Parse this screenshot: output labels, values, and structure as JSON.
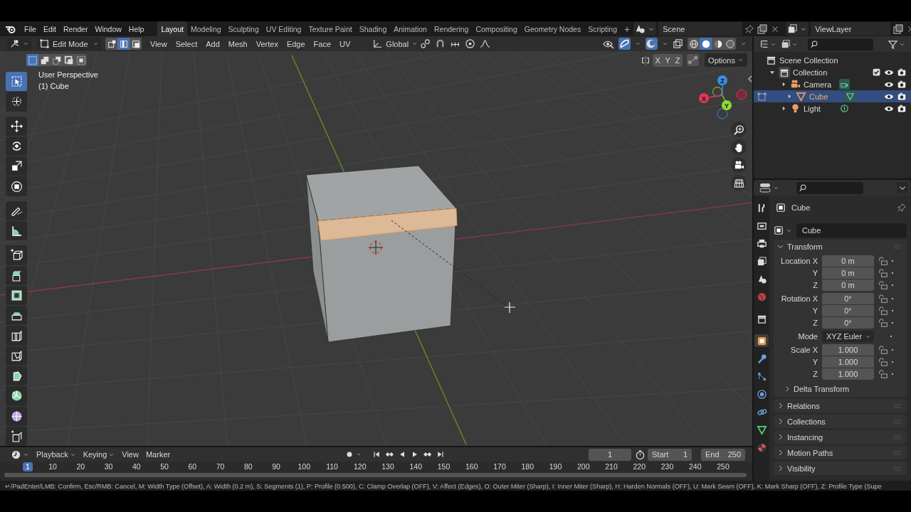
{
  "top_bar": {
    "menus": [
      "File",
      "Edit",
      "Render",
      "Window",
      "Help"
    ],
    "workspaces": [
      {
        "label": "Layout",
        "selected": true
      },
      {
        "label": "Modeling",
        "selected": false
      },
      {
        "label": "Sculpting",
        "selected": false
      },
      {
        "label": "UV Editing",
        "selected": false
      },
      {
        "label": "Texture Paint",
        "selected": false
      },
      {
        "label": "Shading",
        "selected": false
      },
      {
        "label": "Animation",
        "selected": false
      },
      {
        "label": "Rendering",
        "selected": false
      },
      {
        "label": "Compositing",
        "selected": false
      },
      {
        "label": "Geometry Nodes",
        "selected": false
      },
      {
        "label": "Scripting",
        "selected": false
      }
    ],
    "add_workspace": "+",
    "scene": "Scene",
    "view_layer": "ViewLayer"
  },
  "viewport": {
    "mode": "Edit Mode",
    "select_modes": [
      {
        "kind": "vertex",
        "selected": false
      },
      {
        "kind": "edge",
        "selected": true
      },
      {
        "kind": "face",
        "selected": false
      }
    ],
    "menus": [
      "View",
      "Select",
      "Add",
      "Mesh",
      "Vertex",
      "Edge",
      "Face",
      "UV"
    ],
    "orientation": "Global",
    "shading_modes": [
      {
        "kind": "wireframe",
        "selected": false
      },
      {
        "kind": "solid",
        "selected": true
      },
      {
        "kind": "material",
        "selected": false
      },
      {
        "kind": "rendered",
        "selected": false
      }
    ],
    "box_modes": [
      {
        "kind": "set",
        "selected": true
      },
      {
        "kind": "extend",
        "selected": false
      },
      {
        "kind": "subtract",
        "selected": false
      },
      {
        "kind": "invert",
        "selected": false
      },
      {
        "kind": "intersect",
        "selected": false
      }
    ],
    "mirror_axes": [
      "X",
      "Y",
      "Z"
    ],
    "options": "Options",
    "view_name": "User Perspective",
    "object_label": "(1) Cube",
    "gizmo_axes": [
      "X",
      "Y",
      "Z"
    ],
    "tools": [
      {
        "kind": "select_box",
        "selected": true
      },
      {
        "kind": "cursor",
        "selected": false
      },
      {
        "kind": "move",
        "selected": false
      },
      {
        "kind": "rotate",
        "selected": false
      },
      {
        "kind": "scale",
        "selected": false
      },
      {
        "kind": "transform",
        "selected": false
      },
      {
        "kind": "annotate",
        "selected": false
      },
      {
        "kind": "measure",
        "selected": false
      },
      {
        "kind": "add_cube",
        "selected": false
      },
      {
        "kind": "extrude",
        "selected": false
      },
      {
        "kind": "inset",
        "selected": false
      },
      {
        "kind": "bevel",
        "selected": false
      },
      {
        "kind": "loop_cut",
        "selected": false
      },
      {
        "kind": "knife",
        "selected": false
      },
      {
        "kind": "poly_build",
        "selected": false
      },
      {
        "kind": "spin",
        "selected": false
      },
      {
        "kind": "smooth",
        "selected": false
      },
      {
        "kind": "shear",
        "selected": false
      }
    ]
  },
  "outliner": {
    "root": "Scene Collection",
    "collections": [
      {
        "label": "Collection",
        "expanded": true,
        "checked": true,
        "children": [
          {
            "label": "Camera",
            "kind": "camera",
            "selected": false,
            "expanded": false
          },
          {
            "label": "Cube",
            "kind": "mesh",
            "selected": true,
            "expanded": false
          },
          {
            "label": "Light",
            "kind": "light",
            "selected": false,
            "expanded": false
          }
        ]
      }
    ]
  },
  "properties": {
    "tabs": [
      {
        "kind": "tool",
        "selected": false
      },
      {
        "kind": "render",
        "selected": false
      },
      {
        "kind": "output",
        "selected": false
      },
      {
        "kind": "view_layer",
        "selected": false
      },
      {
        "kind": "scene",
        "selected": false
      },
      {
        "kind": "world",
        "selected": false
      },
      {
        "kind": "collection",
        "selected": false
      },
      {
        "kind": "object",
        "selected": true
      },
      {
        "kind": "modifiers",
        "selected": false
      },
      {
        "kind": "particles",
        "selected": false
      },
      {
        "kind": "physics",
        "selected": false
      },
      {
        "kind": "constraints",
        "selected": false
      },
      {
        "kind": "data",
        "selected": false
      },
      {
        "kind": "material",
        "selected": false
      }
    ],
    "object_name": "Cube",
    "name_field": "Cube",
    "panels": [
      {
        "label": "Transform",
        "expanded": true,
        "groups": [
          [
            {
              "label": "Location X",
              "value": "0 m",
              "kind": "field"
            },
            {
              "label": "Y",
              "value": "0 m",
              "kind": "field"
            },
            {
              "label": "Z",
              "value": "0 m",
              "kind": "field"
            }
          ],
          [
            {
              "label": "Rotation X",
              "value": "0°",
              "kind": "field"
            },
            {
              "label": "Y",
              "value": "0°",
              "kind": "field"
            },
            {
              "label": "Z",
              "value": "0°",
              "kind": "field"
            }
          ],
          [
            {
              "label": "Mode",
              "value": "XYZ Euler",
              "kind": "dropdown"
            }
          ],
          [
            {
              "label": "Scale X",
              "value": "1.000",
              "kind": "field"
            },
            {
              "label": "Y",
              "value": "1.000",
              "kind": "field"
            },
            {
              "label": "Z",
              "value": "1.000",
              "kind": "field"
            }
          ]
        ],
        "subpanels": [
          {
            "label": "Delta Transform",
            "expanded": false
          }
        ]
      },
      {
        "label": "Relations",
        "expanded": false
      },
      {
        "label": "Collections",
        "expanded": false
      },
      {
        "label": "Instancing",
        "expanded": false
      },
      {
        "label": "Motion Paths",
        "expanded": false
      },
      {
        "label": "Visibility",
        "expanded": false
      }
    ]
  },
  "timeline": {
    "menus": [
      {
        "label": "Playback",
        "dropdown": true
      },
      {
        "label": "Keying",
        "dropdown": true
      },
      {
        "label": "View",
        "dropdown": false
      },
      {
        "label": "Marker",
        "dropdown": false
      }
    ],
    "current_frame": "1",
    "start_label": "Start",
    "start": "1",
    "end_label": "End",
    "end": "250",
    "ruler": [
      {
        "label": "1",
        "selected": true
      },
      {
        "label": "10",
        "selected": false
      },
      {
        "label": "20",
        "selected": false
      },
      {
        "label": "30",
        "selected": false
      },
      {
        "label": "40",
        "selected": false
      },
      {
        "label": "50",
        "selected": false
      },
      {
        "label": "60",
        "selected": false
      },
      {
        "label": "70",
        "selected": false
      },
      {
        "label": "80",
        "selected": false
      },
      {
        "label": "90",
        "selected": false
      },
      {
        "label": "100",
        "selected": false
      },
      {
        "label": "110",
        "selected": false
      },
      {
        "label": "120",
        "selected": false
      },
      {
        "label": "130",
        "selected": false
      },
      {
        "label": "140",
        "selected": false
      },
      {
        "label": "150",
        "selected": false
      },
      {
        "label": "160",
        "selected": false
      },
      {
        "label": "170",
        "selected": false
      },
      {
        "label": "180",
        "selected": false
      },
      {
        "label": "190",
        "selected": false
      },
      {
        "label": "200",
        "selected": false
      },
      {
        "label": "210",
        "selected": false
      },
      {
        "label": "220",
        "selected": false
      },
      {
        "label": "230",
        "selected": false
      },
      {
        "label": "240",
        "selected": false
      },
      {
        "label": "250",
        "selected": false
      }
    ]
  },
  "status_bar": "↵/PadEnter/LMB: Confirm, Esc/RMB: Cancel, M: Width Type (Offset), A: Width (0.2 m), S: Segments (1), P: Profile (0.500), C: Clamp Overlap (OFF), V: Affect (Edges), O: Outer Miter (Sharp), I: Inner Miter (Sharp), H: Harden Normals (OFF), U: Mark Seam (OFF), K: Mark Sharp (OFF), Z: Profile Type (Supe"
}
